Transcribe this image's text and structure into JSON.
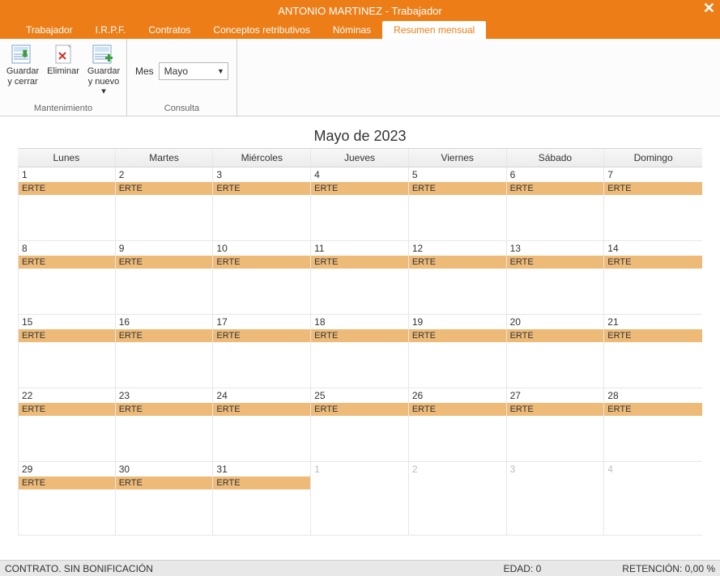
{
  "window": {
    "title": "ANTONIO MARTINEZ - Trabajador",
    "close_glyph": "✕"
  },
  "tabs": [
    {
      "label": "Trabajador"
    },
    {
      "label": "I.R.P.F."
    },
    {
      "label": "Contratos"
    },
    {
      "label": "Conceptos retributivos"
    },
    {
      "label": "Nóminas"
    },
    {
      "label": "Resumen mensual",
      "active": true
    }
  ],
  "ribbon": {
    "maint_group_label": "Mantenimiento",
    "consult_group_label": "Consulta",
    "buttons": {
      "save_close": {
        "line1": "Guardar",
        "line2": "y cerrar"
      },
      "delete": {
        "line1": "Eliminar",
        "line2": ""
      },
      "save_new": {
        "line1": "Guardar",
        "line2": "y nuevo ▾"
      }
    },
    "month_label": "Mes",
    "month_value": "Mayo"
  },
  "calendar": {
    "title": "Mayo de 2023",
    "day_headers": [
      "Lunes",
      "Martes",
      "Miércoles",
      "Jueves",
      "Viernes",
      "Sábado",
      "Domingo"
    ],
    "cells": [
      {
        "day": "1",
        "event": "ERTE"
      },
      {
        "day": "2",
        "event": "ERTE"
      },
      {
        "day": "3",
        "event": "ERTE"
      },
      {
        "day": "4",
        "event": "ERTE"
      },
      {
        "day": "5",
        "event": "ERTE"
      },
      {
        "day": "6",
        "event": "ERTE"
      },
      {
        "day": "7",
        "event": "ERTE"
      },
      {
        "day": "8",
        "event": "ERTE"
      },
      {
        "day": "9",
        "event": "ERTE"
      },
      {
        "day": "10",
        "event": "ERTE"
      },
      {
        "day": "11",
        "event": "ERTE"
      },
      {
        "day": "12",
        "event": "ERTE"
      },
      {
        "day": "13",
        "event": "ERTE"
      },
      {
        "day": "14",
        "event": "ERTE"
      },
      {
        "day": "15",
        "event": "ERTE"
      },
      {
        "day": "16",
        "event": "ERTE"
      },
      {
        "day": "17",
        "event": "ERTE"
      },
      {
        "day": "18",
        "event": "ERTE"
      },
      {
        "day": "19",
        "event": "ERTE"
      },
      {
        "day": "20",
        "event": "ERTE"
      },
      {
        "day": "21",
        "event": "ERTE"
      },
      {
        "day": "22",
        "event": "ERTE"
      },
      {
        "day": "23",
        "event": "ERTE"
      },
      {
        "day": "24",
        "event": "ERTE"
      },
      {
        "day": "25",
        "event": "ERTE"
      },
      {
        "day": "26",
        "event": "ERTE"
      },
      {
        "day": "27",
        "event": "ERTE"
      },
      {
        "day": "28",
        "event": "ERTE"
      },
      {
        "day": "29",
        "event": "ERTE"
      },
      {
        "day": "30",
        "event": "ERTE"
      },
      {
        "day": "31",
        "event": "ERTE"
      },
      {
        "day": "1",
        "outside": true
      },
      {
        "day": "2",
        "outside": true
      },
      {
        "day": "3",
        "outside": true
      },
      {
        "day": "4",
        "outside": true
      }
    ]
  },
  "status": {
    "contrato": "CONTRATO.  SIN BONIFICACIÓN",
    "edad": "EDAD: 0",
    "retencion": "RETENCIÓN: 0,00 %"
  }
}
